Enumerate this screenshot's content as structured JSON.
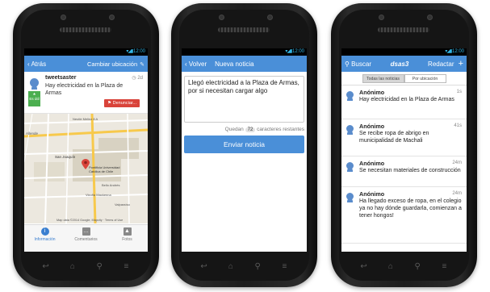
{
  "status": {
    "time": "12:00",
    "signal_icon": "wifi-signal-battery-icon"
  },
  "screen1": {
    "back_label": "Atrás",
    "change_location_label": "Cambiar ubicación",
    "post": {
      "user": "tweetsaster",
      "time": "2d",
      "message": "Hay electricidad en la Plaza de Armas",
      "badge": "Es útil",
      "report_label": "Denunciar..."
    },
    "map": {
      "labels": [
        "Neutle Melinz 8 A",
        "Allende",
        "San Joaquín",
        "Pontificia Universidad Católica de Chile",
        "Vicuña Mackenna",
        "Bello Andrés",
        "Valparaíso"
      ],
      "attribution": "Map data ©2014 Google, Mapcity · Terms of Use"
    },
    "tabs": [
      {
        "label": "Información",
        "icon": "info-icon"
      },
      {
        "label": "Comentarios",
        "icon": "comments-icon"
      },
      {
        "label": "Fotos",
        "icon": "photos-icon"
      }
    ]
  },
  "screen2": {
    "back_label": "Volver",
    "title": "Nueva noticia",
    "compose_text": "Llegó electricidad a la Plaza de Armas, por si necesitan cargar algo",
    "remaining_prefix": "Quedan",
    "remaining_count": "72",
    "remaining_suffix": "caracteres restantes",
    "send_label": "Enviar noticia"
  },
  "screen3": {
    "search_label": "Buscar",
    "title": "dsas3",
    "compose_label": "Redactar",
    "segments": [
      "Todas las noticias",
      "Por ubicación"
    ],
    "feed": [
      {
        "user": "Anónimo",
        "time": "1s",
        "message": "Hay electricidad en la Plaza de Armas"
      },
      {
        "user": "Anónimo",
        "time": "41s",
        "message": "Se recibe ropa de abrigo en municipalidad de Machali"
      },
      {
        "user": "Anónimo",
        "time": "24m",
        "message": "Se necesitan materiales de construcción"
      },
      {
        "user": "Anónimo",
        "time": "24m",
        "message": "Ha llegado exceso de ropa, en el colegio ya no hay dónde guardarla, comienzan a tener hongos!"
      }
    ]
  },
  "colors": {
    "accent": "#4a8fd8",
    "report": "#d9433a",
    "badge": "#4caf50",
    "statusbar_icons": "#33b5e5"
  }
}
